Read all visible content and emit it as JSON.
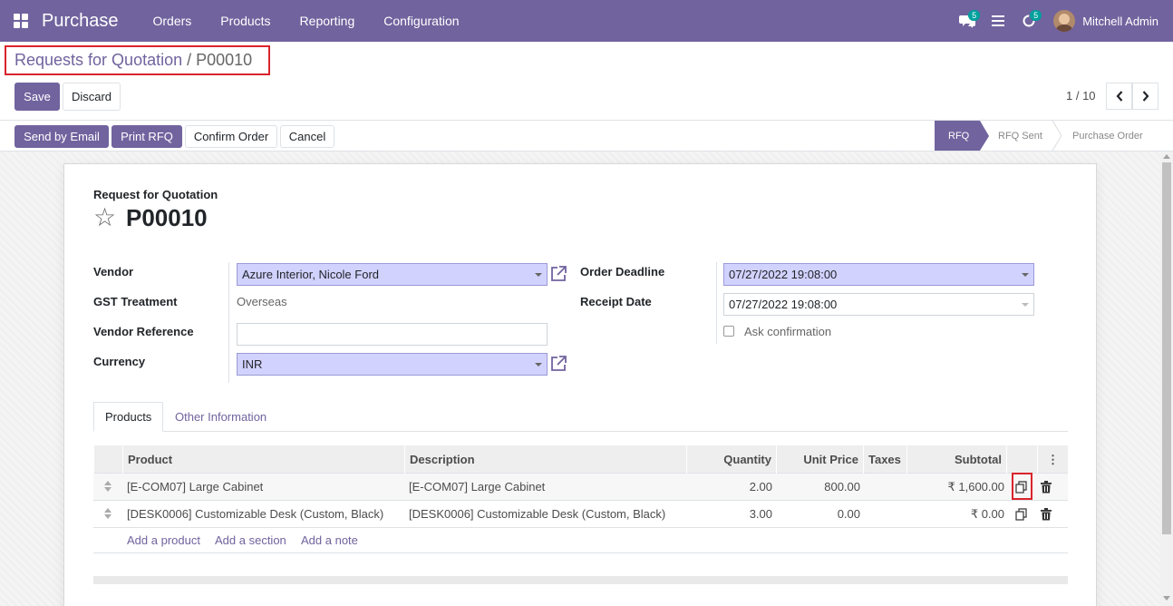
{
  "navbar": {
    "app_name": "Purchase",
    "menu": [
      "Orders",
      "Products",
      "Reporting",
      "Configuration"
    ],
    "messages_count": "5",
    "activities_count": "5",
    "user_name": "Mitchell Admin"
  },
  "breadcrumb": {
    "parent": "Requests for Quotation",
    "separator": "/",
    "current": "P00010"
  },
  "actions": {
    "save": "Save",
    "discard": "Discard"
  },
  "pager": {
    "value": "1 / 10"
  },
  "statusbar": {
    "buttons": [
      "Send by Email",
      "Print RFQ",
      "Confirm Order",
      "Cancel"
    ],
    "stages": [
      "RFQ",
      "RFQ Sent",
      "Purchase Order"
    ],
    "active_stage": "RFQ"
  },
  "form": {
    "doc_label": "Request for Quotation",
    "doc_name": "P00010",
    "vendor_label": "Vendor",
    "vendor_value": "Azure Interior, Nicole Ford",
    "gst_label": "GST Treatment",
    "gst_value": "Overseas",
    "vendor_ref_label": "Vendor Reference",
    "vendor_ref_value": "",
    "currency_label": "Currency",
    "currency_value": "INR",
    "order_deadline_label": "Order Deadline",
    "order_deadline_value": "07/27/2022 19:08:00",
    "receipt_date_label": "Receipt Date",
    "receipt_date_value": "07/27/2022 19:08:00",
    "ask_confirmation_label": "Ask confirmation"
  },
  "tabs": {
    "products": "Products",
    "other_info": "Other Information"
  },
  "lines": {
    "headers": {
      "product": "Product",
      "description": "Description",
      "quantity": "Quantity",
      "unit_price": "Unit Price",
      "taxes": "Taxes",
      "subtotal": "Subtotal"
    },
    "rows": [
      {
        "product": "[E-COM07] Large Cabinet",
        "description": "[E-COM07] Large Cabinet",
        "quantity": "2.00",
        "unit_price": "800.00",
        "taxes": "",
        "subtotal": "₹ 1,600.00"
      },
      {
        "product": "[DESK0006] Customizable Desk (Custom, Black)",
        "description": "[DESK0006] Customizable Desk (Custom, Black)",
        "quantity": "3.00",
        "unit_price": "0.00",
        "taxes": "",
        "subtotal": "₹ 0.00"
      }
    ],
    "add_product": "Add a product",
    "add_section": "Add a section",
    "add_note": "Add a note"
  },
  "colors": {
    "brand": "#71639e",
    "required_field": "#d2d2ff",
    "highlight": "#d9242c"
  }
}
